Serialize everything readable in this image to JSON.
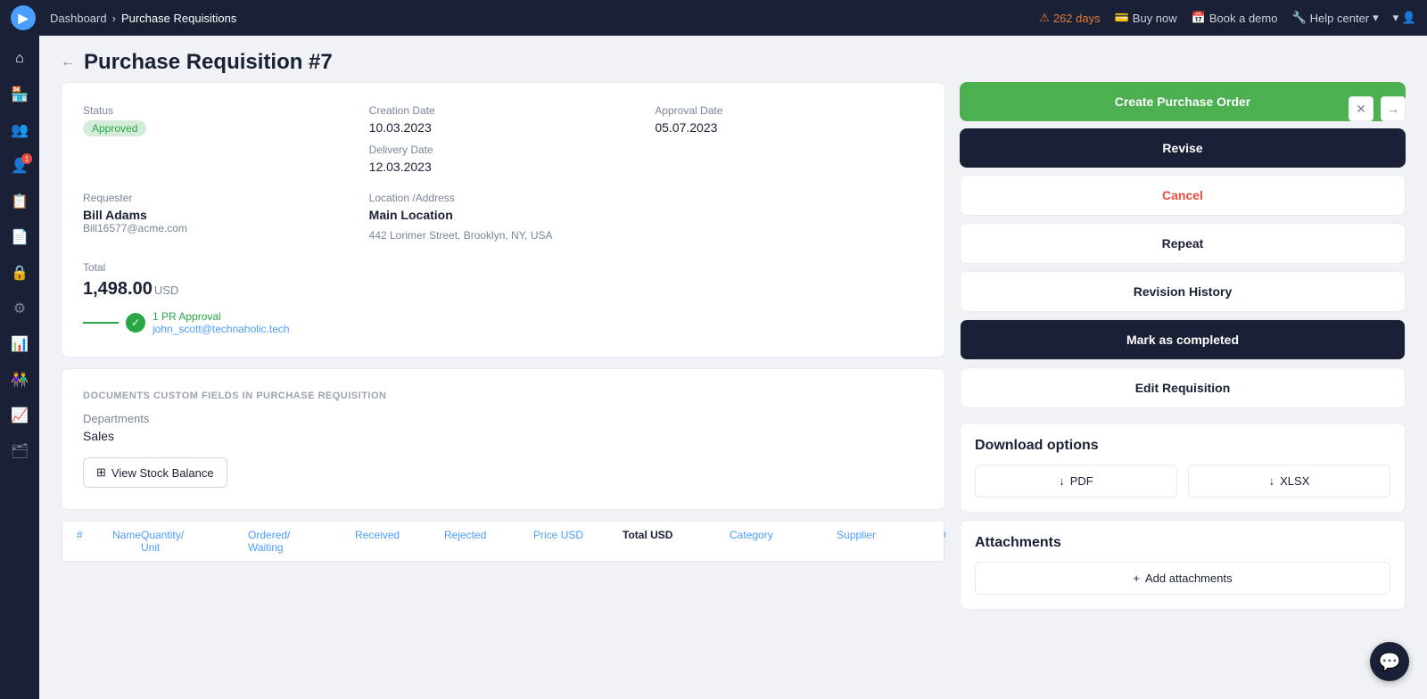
{
  "topnav": {
    "logo_text": "▶",
    "breadcrumb_home": "Dashboard",
    "breadcrumb_current": "Purchase Requisitions",
    "alert_days": "262 days",
    "btn_buy_now": "Buy now",
    "btn_book_demo": "Book a demo",
    "btn_help_center": "Help center"
  },
  "sidebar": {
    "icons": [
      {
        "name": "home-icon",
        "symbol": "⌂"
      },
      {
        "name": "store-icon",
        "symbol": "🏪"
      },
      {
        "name": "users-icon",
        "symbol": "👥"
      },
      {
        "name": "person-icon",
        "symbol": "👤"
      },
      {
        "name": "clipboard-icon",
        "symbol": "📋"
      },
      {
        "name": "document-icon",
        "symbol": "📄"
      },
      {
        "name": "lock-icon",
        "symbol": "🔒"
      },
      {
        "name": "settings-icon",
        "symbol": "⚙"
      },
      {
        "name": "chart-icon",
        "symbol": "📊"
      },
      {
        "name": "team-icon",
        "symbol": "👫"
      },
      {
        "name": "analytics-icon",
        "symbol": "📈"
      },
      {
        "name": "layers-icon",
        "symbol": "🗂"
      }
    ]
  },
  "page": {
    "title": "Purchase Requisition #7",
    "back_label": "←"
  },
  "info": {
    "status_label": "Status",
    "status_value": "Approved",
    "creation_date_label": "Creation Date",
    "creation_date": "10.03.2023",
    "approval_date_label": "Approval Date",
    "approval_date": "05.07.2023",
    "delivery_date_label": "Delivery Date",
    "delivery_date": "12.03.2023",
    "requester_label": "Requester",
    "requester_name": "Bill Adams",
    "requester_email": "Bill16577@acme.com",
    "location_label": "Location /Address",
    "location_name": "Main Location",
    "location_address": "442 Lorimer Street, Brooklyn, NY, USA",
    "total_label": "Total",
    "total_value": "1,498.00",
    "total_currency": "USD",
    "approval_count": "1 PR Approval",
    "approval_email": "john_scott@technaholic.tech"
  },
  "documents": {
    "section_label": "DOCUMENTS CUSTOM FIELDS IN PURCHASE REQUISITION",
    "field_name": "Departments",
    "field_value": "Sales"
  },
  "table": {
    "view_stock_btn": "View Stock Balance",
    "cols": [
      {
        "label": "#",
        "color": "link"
      },
      {
        "label": "Name",
        "color": "link"
      },
      {
        "label": "Quantity/ Unit",
        "color": "default"
      },
      {
        "label": "Ordered/ Waiting",
        "color": "default"
      },
      {
        "label": "Received",
        "color": "default"
      },
      {
        "label": "Rejected",
        "color": "default"
      },
      {
        "label": "Price USD",
        "color": "link"
      },
      {
        "label": "Total USD",
        "color": "dark"
      },
      {
        "label": "Category",
        "color": "link"
      },
      {
        "label": "Supplier",
        "color": "link"
      },
      {
        "label": "Chart of Accounts ℹ",
        "color": "default"
      }
    ]
  },
  "actions": {
    "create_po": "Create Purchase Order",
    "revise": "Revise",
    "cancel": "Cancel",
    "repeat": "Repeat",
    "revision_history": "Revision History",
    "mark_completed": "Mark as completed",
    "edit_requisition": "Edit Requisition"
  },
  "download": {
    "title": "Download options",
    "pdf_label": "PDF",
    "xlsx_label": "XLSX",
    "pdf_icon": "↓",
    "xlsx_icon": "↓"
  },
  "attachments": {
    "title": "Attachments",
    "add_label": "Add attachments",
    "add_icon": "+"
  }
}
